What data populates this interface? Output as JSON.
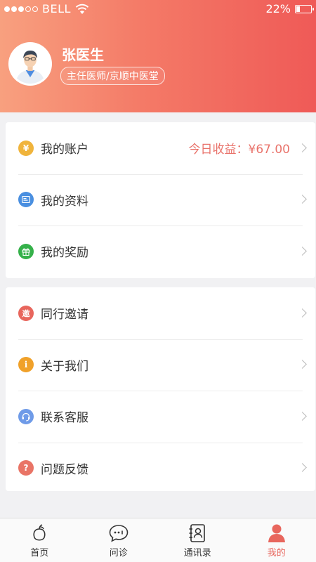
{
  "status_bar": {
    "carrier": "BELL",
    "battery": "22%"
  },
  "profile": {
    "name": "张医生",
    "title": "主任医师/京顺中医堂"
  },
  "menu_groups": [
    {
      "items": [
        {
          "label": "我的账户",
          "icon": "yen-icon",
          "icon_color": "#f0b43c",
          "extra": "今日收益：¥67.00"
        },
        {
          "label": "我的资料",
          "icon": "profile-card-icon",
          "icon_color": "#4a8fe0"
        },
        {
          "label": "我的奖励",
          "icon": "gift-icon",
          "icon_color": "#35b14a"
        }
      ]
    },
    {
      "items": [
        {
          "label": "同行邀请",
          "icon": "invite-icon",
          "icon_color": "#e8665d",
          "icon_glyph": "邀"
        },
        {
          "label": "关于我们",
          "icon": "info-icon",
          "icon_color": "#f0a12a"
        },
        {
          "label": "联系客服",
          "icon": "headset-icon",
          "icon_color": "#6f9be8"
        },
        {
          "label": "问题反馈",
          "icon": "question-icon",
          "icon_color": "#e97466"
        }
      ]
    }
  ],
  "tabbar": {
    "tabs": [
      {
        "label": "首页",
        "icon": "home-icon"
      },
      {
        "label": "问诊",
        "icon": "chat-icon"
      },
      {
        "label": "通讯录",
        "icon": "contacts-icon"
      },
      {
        "label": "我的",
        "icon": "user-icon",
        "active": true
      }
    ]
  },
  "colors": {
    "accent": "#e8665d",
    "header_gradient_start": "#f8a07f",
    "header_gradient_end": "#ef5a57"
  }
}
